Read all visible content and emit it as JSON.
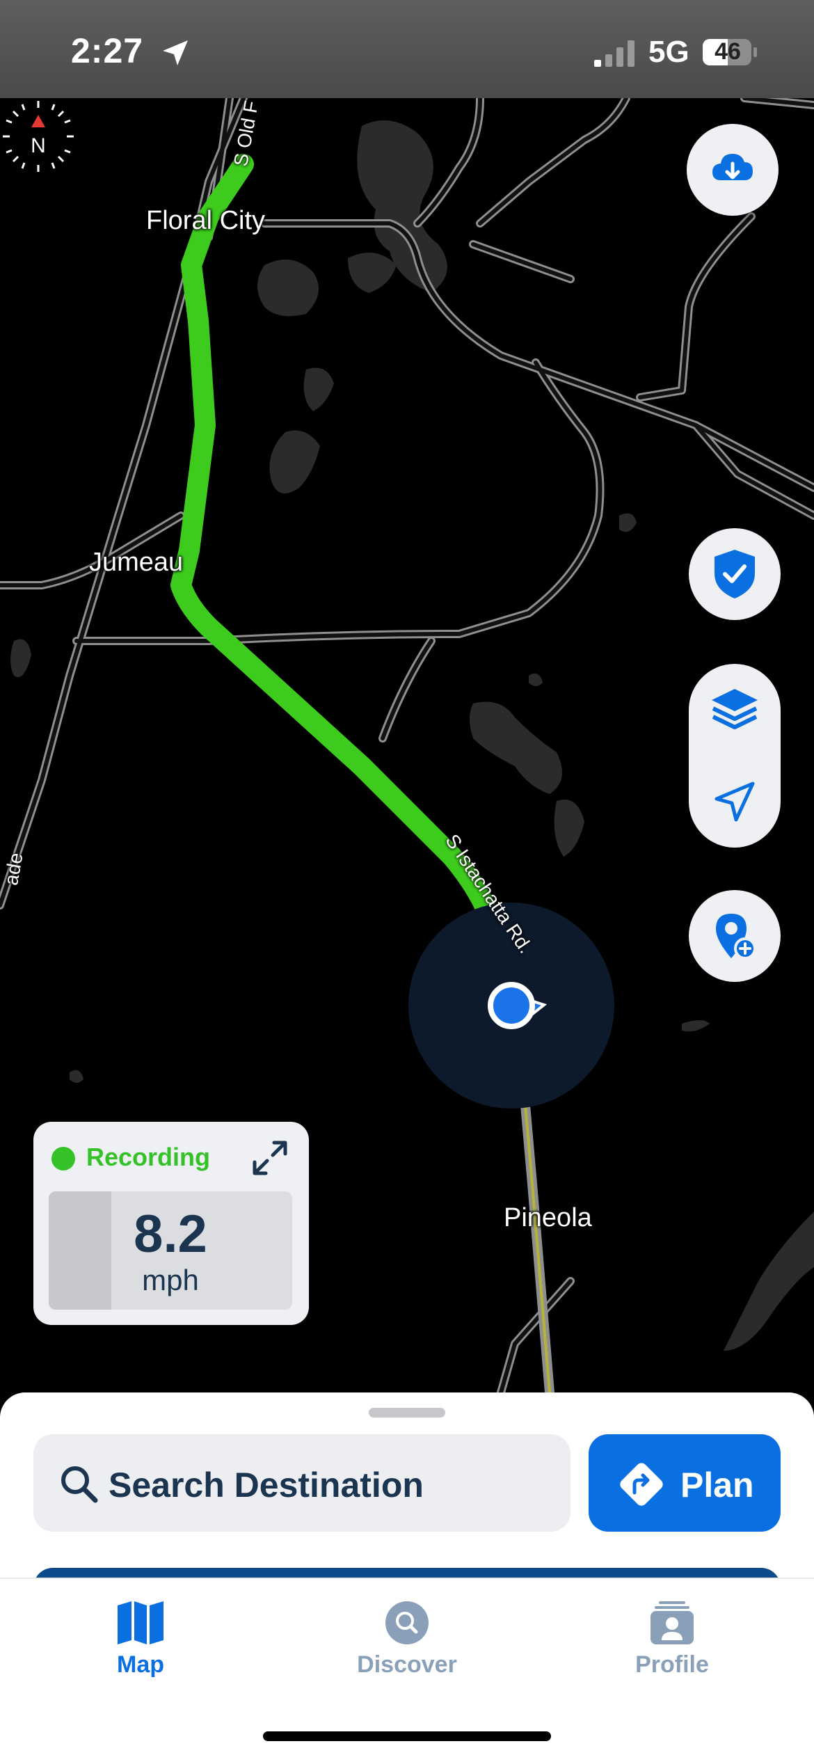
{
  "status_bar": {
    "time": "2:27",
    "network": "5G",
    "battery": "46",
    "icons": [
      "location-arrow-icon",
      "signal-icon",
      "battery-icon"
    ]
  },
  "map": {
    "places": {
      "floral_city": "Floral City",
      "jumeau": "Jumeau",
      "pineola": "Pineola"
    },
    "roads": {
      "old_floral": "S Old F",
      "istachatta": "S Istachatta Rd.",
      "left_edge": "ade"
    },
    "compass_label": "N",
    "route_color": "#3dcc1e",
    "location_color": "#1a73e8"
  },
  "controls": {
    "icons": [
      "cloud-download-icon",
      "compass-icon",
      "shield-check-icon",
      "layers-icon",
      "navigation-arrow-icon",
      "add-location-icon"
    ]
  },
  "recording": {
    "status": "Recording",
    "speed": "8.2",
    "unit": "mph",
    "status_color": "#35c229"
  },
  "sheet": {
    "search_placeholder": "Search Destination",
    "plan_label": "Plan"
  },
  "tabs": [
    {
      "label": "Map",
      "icon": "map-icon",
      "active": true
    },
    {
      "label": "Discover",
      "icon": "discover-icon",
      "active": false
    },
    {
      "label": "Profile",
      "icon": "profile-icon",
      "active": false
    }
  ],
  "colors": {
    "accent": "#0a6fe0",
    "navy": "#1b3450",
    "inactive_tab": "#8aa0b8"
  }
}
